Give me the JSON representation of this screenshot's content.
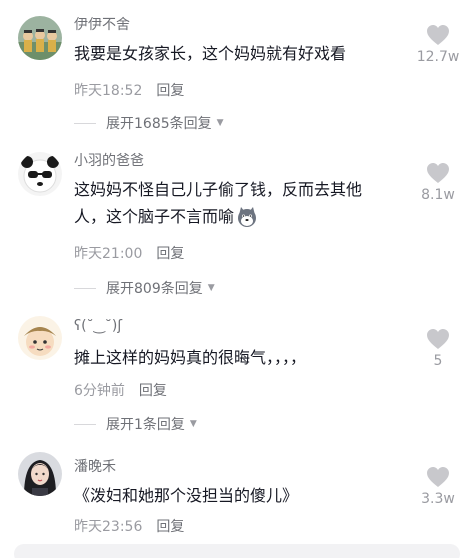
{
  "comments": [
    {
      "username": "伊伊不舍",
      "text": "我要是女孩家长，这个妈妈就有好戏看",
      "time": "昨天18:52",
      "reply_label": "回复",
      "likes": "12.7w",
      "expand_label": "展开1685条回复",
      "avatar_icon": "group-photo-avatar-icon"
    },
    {
      "username": "小羽的爸爸",
      "text_line1": "这妈妈不怪自己儿子偷了钱，反而去其他",
      "text_line2": "人，这个脑子不言而喻",
      "time": "昨天21:00",
      "reply_label": "回复",
      "likes": "8.1w",
      "expand_label": "展开809条回复",
      "avatar_icon": "panda-sunglasses-avatar-icon",
      "emoji_icon": "husky-emoji-icon"
    },
    {
      "username": "ʕ(˘‿˘)ʃ",
      "text": "摊上这样的妈妈真的很晦气，，，，",
      "time": "6分钟前",
      "reply_label": "回复",
      "likes": "5",
      "expand_label": "展开1条回复",
      "avatar_icon": "cartoon-boy-avatar-icon"
    },
    {
      "username": "潘晚禾",
      "text": "《泼妇和她那个没担当的傻儿》",
      "time": "昨天23:56",
      "reply_label": "回复",
      "likes": "3.3w",
      "avatar_icon": "girl-portrait-avatar-icon"
    }
  ],
  "colors": {
    "text_primary": "#161823",
    "text_secondary": "#6f7177",
    "text_tertiary": "#9a9ba1",
    "heart": "#c8c8cc"
  }
}
